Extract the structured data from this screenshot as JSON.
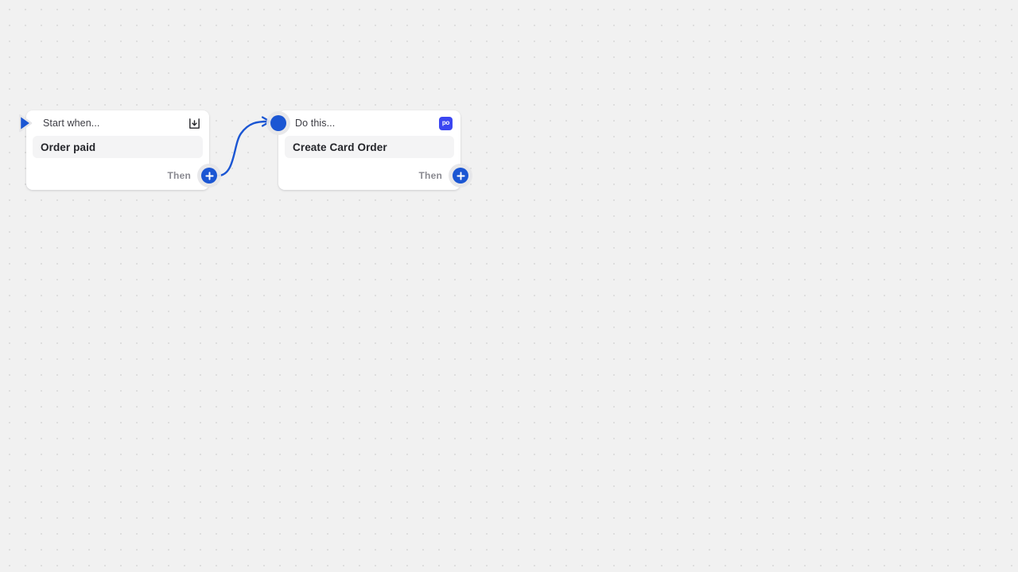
{
  "canvas": {
    "background_color": "#f1f1f1",
    "dot_color": "#dedede",
    "dot_spacing_px": 20
  },
  "theme": {
    "accent_blue": "#1b56d3",
    "brand_chip_blue": "#3b46f1",
    "card_background": "#ffffff",
    "field_background": "#f4f4f5",
    "header_text": "#3c3c43",
    "field_text": "#25262b",
    "muted_text": "#8a8a91"
  },
  "nodes": [
    {
      "id": "trigger",
      "header_title": "Start when...",
      "header_icon": "inbox-download-icon",
      "field_value": "Order paid",
      "footer_label": "Then",
      "input_handle_icon": "play-triangle-icon",
      "output_handle_icon": "plus-icon"
    },
    {
      "id": "action",
      "header_title": "Do this...",
      "header_icon": "brand-chip-icon",
      "header_icon_text": "po",
      "field_value": "Create Card Order",
      "footer_label": "Then",
      "input_handle_icon": "dot-handle-icon",
      "output_handle_icon": "plus-icon"
    }
  ],
  "connector": {
    "from_node": "trigger",
    "to_node": "action",
    "style": "curved-arrow",
    "color": "#1b56d3"
  }
}
